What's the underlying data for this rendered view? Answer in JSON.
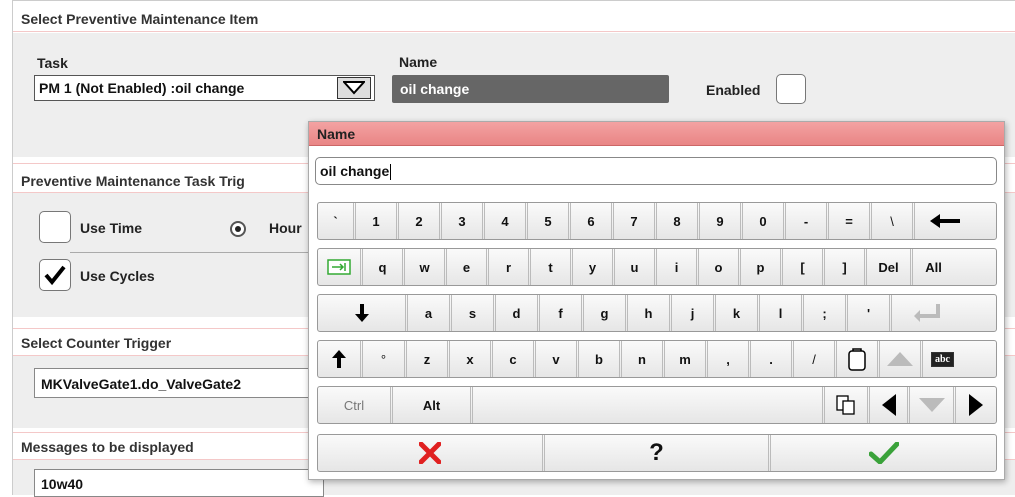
{
  "section1": {
    "title": "Select Preventive Maintenance Item",
    "task_label": "Task",
    "task_value": "PM 1 (Not Enabled) :oil change",
    "name_label": "Name",
    "name_value": "oil change",
    "enabled_label": "Enabled"
  },
  "section2": {
    "title": "Preventive Maintenance Task Trig",
    "use_time_label": "Use Time",
    "hours_label": "Hour",
    "use_cycles_label": "Use Cycles",
    "use_time_checked": false,
    "use_cycles_checked": true
  },
  "section3": {
    "title": "Select Counter Trigger",
    "counter_value": "MKValveGate1.do_ValveGate2"
  },
  "section4": {
    "title": "Messages to be displayed",
    "message_value": "10w40"
  },
  "keyboard": {
    "title": "Name",
    "input_value": "oil change",
    "row1": [
      "`",
      "1",
      "2",
      "3",
      "4",
      "5",
      "6",
      "7",
      "8",
      "9",
      "0",
      "-",
      "=",
      "\\",
      "←"
    ],
    "row2": [
      "⇥",
      "q",
      "w",
      "e",
      "r",
      "t",
      "y",
      "u",
      "i",
      "o",
      "p",
      "[",
      "]",
      "Del",
      "All"
    ],
    "row3": [
      "↓",
      "a",
      "s",
      "d",
      "f",
      "g",
      "h",
      "j",
      "k",
      "l",
      ";",
      "'",
      "↵"
    ],
    "row4": [
      "↑",
      "°",
      "z",
      "x",
      "c",
      "v",
      "b",
      "n",
      "m",
      ",",
      ".",
      "/",
      "clipboard",
      "▲",
      "abc"
    ],
    "row5": {
      "ctrl": "Ctrl",
      "alt": "Alt"
    },
    "actions": {
      "cancel": "✕",
      "help": "?",
      "ok": "✓"
    }
  },
  "colors": {
    "title_bar": "#ee9090",
    "name_field_bg": "#666666",
    "cancel": "#e02020",
    "ok": "#3aa23a"
  }
}
